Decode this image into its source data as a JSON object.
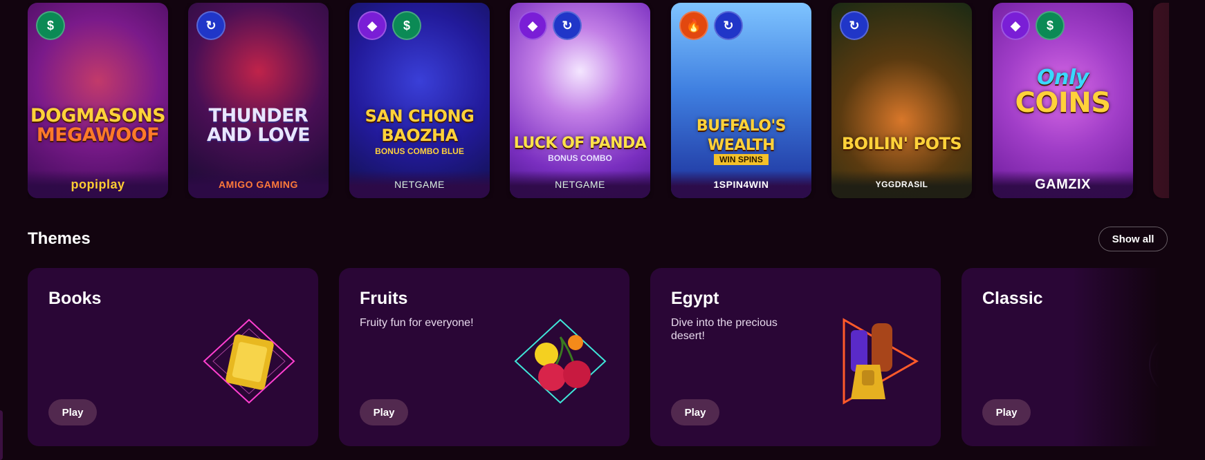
{
  "games": [
    {
      "title_line1": "DOGMASONS",
      "title_line2": "MEGAWOOF",
      "subtitle": "",
      "provider": "popiplay",
      "badges": [
        "cash"
      ]
    },
    {
      "title_line1": "THUNDER",
      "title_line2": "AND LOVE",
      "subtitle": "",
      "provider": "AMIGO GAMING",
      "badges": [
        "spin"
      ]
    },
    {
      "title_line1": "SAN CHONG",
      "title_line2": "BAOZHA",
      "subtitle": "BONUS COMBO BLUE",
      "provider": "NETGAME",
      "badges": [
        "gem",
        "cash"
      ]
    },
    {
      "title_line1": "LUCK OF PANDA",
      "title_line2": "",
      "subtitle": "BONUS COMBO",
      "provider": "NETGAME",
      "badges": [
        "gem",
        "spin"
      ]
    },
    {
      "title_line1": "BUFFALO'S",
      "title_line2": "WEALTH",
      "subtitle": "WIN SPINS",
      "provider": "1SPIN4WIN",
      "badges": [
        "fire",
        "spin"
      ]
    },
    {
      "title_line1": "BOILIN' POTS",
      "title_line2": "",
      "subtitle": "",
      "provider": "YGGDRASIL",
      "badges": [
        "spin"
      ]
    },
    {
      "title_line1": "Only",
      "title_line2": "COINS",
      "subtitle": "",
      "provider": "GAMZIX",
      "badges": [
        "gem",
        "cash"
      ]
    }
  ],
  "themes_section": {
    "title": "Themes",
    "show_all_label": "Show all"
  },
  "themes": [
    {
      "title": "Books",
      "description": "",
      "play_label": "Play",
      "icon": "book-icon"
    },
    {
      "title": "Fruits",
      "description": "Fruity fun for everyone!",
      "play_label": "Play",
      "icon": "cherries-icon"
    },
    {
      "title": "Egypt",
      "description": "Dive into the precious desert!",
      "play_label": "Play",
      "icon": "pharaoh-icon"
    },
    {
      "title": "Classic",
      "description": "",
      "play_label": "Play",
      "icon": "classic-icon"
    }
  ],
  "badge_icons": {
    "cash": "$",
    "gem": "◆",
    "spin": "↻",
    "fire": "🔥"
  },
  "colors": {
    "background": "#12040f",
    "theme_card": "#2a0636",
    "play_button": "#52294f"
  }
}
